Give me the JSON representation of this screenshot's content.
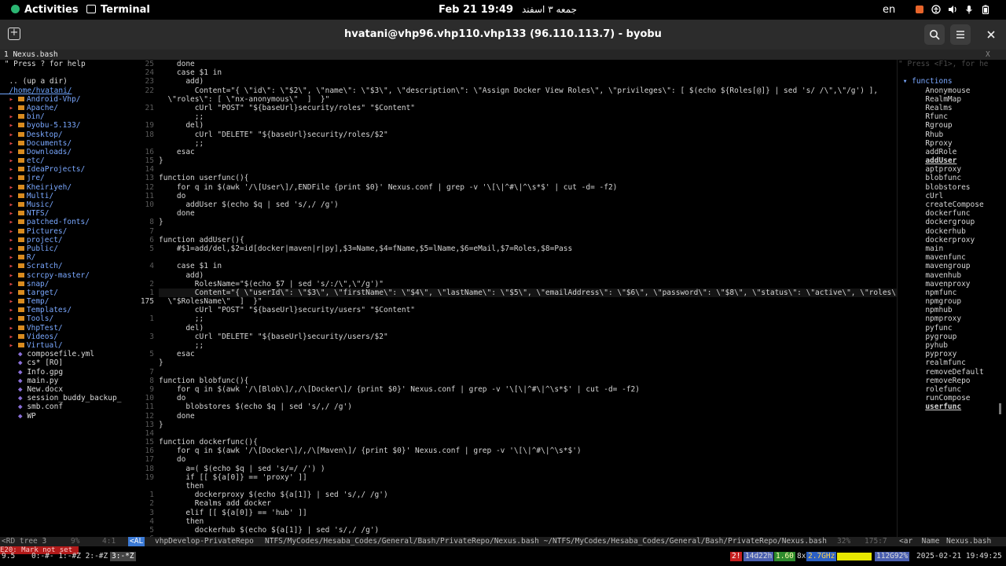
{
  "topbar": {
    "activities": "Activities",
    "app": "Terminal",
    "clock": "Feb 21  19:49",
    "persian_date": "جمعه ۳ اسفند",
    "lang": "en",
    "tray_icons": [
      "app-indicator-icon",
      "accessibility-icon",
      "volume-icon",
      "microphone-icon",
      "battery-icon"
    ]
  },
  "window": {
    "title": "hvatani@vhp96.vhp110.vhp133 (96.110.113.7) - byobu",
    "new_tab_icon": "new-tab-icon",
    "search_icon": "search-icon",
    "menu_icon": "hamburger-menu-icon",
    "close_icon": "close-icon"
  },
  "tabline": {
    "label": "1 Nexus.bash",
    "close": "X"
  },
  "tree": {
    "lines": [
      {
        "text": "\" Press ? for help",
        "kind": "help"
      },
      {
        "text": "",
        "kind": "help"
      },
      {
        "text": ".. (up a dir)",
        "kind": "file"
      },
      {
        "text": "/home/hvatani/",
        "kind": "root"
      },
      {
        "text": "Android-Vhp/",
        "kind": "dir"
      },
      {
        "text": "Apache/",
        "kind": "dir"
      },
      {
        "text": "bin/",
        "kind": "dir"
      },
      {
        "text": "byobu-5.133/",
        "kind": "dir"
      },
      {
        "text": "Desktop/",
        "kind": "dir"
      },
      {
        "text": "Documents/",
        "kind": "dir"
      },
      {
        "text": "Downloads/",
        "kind": "dir"
      },
      {
        "text": "etc/",
        "kind": "dir"
      },
      {
        "text": "IdeaProjects/",
        "kind": "dir"
      },
      {
        "text": "jre/",
        "kind": "dir"
      },
      {
        "text": "Kheiriyeh/",
        "kind": "dir"
      },
      {
        "text": "Multi/",
        "kind": "dir"
      },
      {
        "text": "Music/",
        "kind": "dir"
      },
      {
        "text": "NTFS/",
        "kind": "dir"
      },
      {
        "text": "patched-fonts/",
        "kind": "dir"
      },
      {
        "text": "Pictures/",
        "kind": "dir"
      },
      {
        "text": "project/",
        "kind": "dir"
      },
      {
        "text": "Public/",
        "kind": "dir"
      },
      {
        "text": "R/",
        "kind": "dir"
      },
      {
        "text": "Scratch/",
        "kind": "dir"
      },
      {
        "text": "scrcpy-master/",
        "kind": "dir"
      },
      {
        "text": "snap/",
        "kind": "dir"
      },
      {
        "text": "target/",
        "kind": "dir"
      },
      {
        "text": "Temp/",
        "kind": "dir"
      },
      {
        "text": "Templates/",
        "kind": "dir"
      },
      {
        "text": "Tools/",
        "kind": "dir"
      },
      {
        "text": "VhpTest/",
        "kind": "dir"
      },
      {
        "text": "Videos/",
        "kind": "dir"
      },
      {
        "text": "Virtual/",
        "kind": "dir"
      },
      {
        "text": "composefile.yml",
        "kind": "file"
      },
      {
        "text": "cs* [RO]",
        "kind": "file"
      },
      {
        "text": "Info.gpg",
        "kind": "file"
      },
      {
        "text": "main.py",
        "kind": "file"
      },
      {
        "text": "New.docx",
        "kind": "file"
      },
      {
        "text": "session_buddy_backup_",
        "kind": "file"
      },
      {
        "text": "smb.conf",
        "kind": "file"
      },
      {
        "text": "WP",
        "kind": "file"
      }
    ]
  },
  "gutter": [
    "25",
    "24",
    "23",
    "22",
    "",
    "21",
    "",
    "19",
    "18",
    "",
    "16",
    "15",
    "14",
    "13",
    "12",
    "11",
    "10",
    "",
    "8",
    "7",
    "6",
    "5",
    "",
    "4",
    "",
    "2",
    "1",
    "175",
    "",
    "1",
    "",
    "3",
    "",
    "5",
    "",
    "7",
    "8",
    "9",
    "10",
    "11",
    "12",
    "13",
    "14",
    "15",
    "16",
    "17",
    "18",
    "19",
    "",
    "1",
    "2",
    "3",
    "4",
    "5",
    "6",
    "7",
    ""
  ],
  "code": [
    {
      "text": "    done",
      "kw": true
    },
    {
      "text": "    case $1 in",
      "kw": true
    },
    {
      "text": "      add)"
    },
    {
      "text": "        Content=\"{ \\\"id\\\": \\\"$2\\\", \\\"name\\\": \\\"$3\\\", \\\"description\\\": \\\"Assign Docker View Roles\\\", \\\"privileges\\\": [ $(echo ${Roles[@]} | sed 's/ /\\\",\\\"/g') ],"
    },
    {
      "text": "  \\\"roles\\\": [ \\\"nx-anonymous\\\"  ]  }\""
    },
    {
      "text": "        cUrl \"POST\" \"${baseUrl}security/roles\" \"$Content\""
    },
    {
      "text": "        ;;",
      "cmt": true
    },
    {
      "text": "      del)"
    },
    {
      "text": "        cUrl \"DELETE\" \"${baseUrl}security/roles/$2\""
    },
    {
      "text": "        ;;",
      "cmt": true
    },
    {
      "text": "    esac",
      "kw": true
    },
    {
      "text": "}"
    },
    {
      "text": ""
    },
    {
      "text": "function userfunc(){"
    },
    {
      "text": "    for q in $(awk '/\\[User\\]/,ENDFile {print $0}' Nexus.conf | grep -v '\\[\\|^#\\|^\\s*$' | cut -d= -f2)"
    },
    {
      "text": "    do",
      "kw": true
    },
    {
      "text": "      addUser $(echo $q | sed 's/,/ /g')"
    },
    {
      "text": "    done",
      "kw": true
    },
    {
      "text": "}"
    },
    {
      "text": ""
    },
    {
      "text": "function addUser(){"
    },
    {
      "text": "    #$1=add/del,$2=id[docker|maven|r|py],$3=Name,$4=fName,$5=lName,$6=eMail,$7=Roles,$8=Pass",
      "cmt": true
    },
    {
      "text": ""
    },
    {
      "text": "    case $1 in",
      "kw": true
    },
    {
      "text": "      add)"
    },
    {
      "text": "        RolesName=\"$(echo $7 | sed 's/:/\\\",\\\"/g')\""
    },
    {
      "text": "        Content=\"{ \\\"userId\\\": \\\"$3\\\", \\\"firstName\\\": \\\"$4\\\", \\\"lastName\\\": \\\"$5\\\", \\\"emailAddress\\\": \\\"$6\\\", \\\"password\\\": \\\"$8\\\", \\\"status\\\": \\\"active\\\", \\\"roles\\\": [",
      "cur": true
    },
    {
      "text": "  \\\"$RolesName\\\"  ]  }\""
    },
    {
      "text": "        cUrl \"POST\" \"${baseUrl}security/users\" \"$Content\""
    },
    {
      "text": "        ;;",
      "cmt": true
    },
    {
      "text": "      del)"
    },
    {
      "text": "        cUrl \"DELETE\" \"${baseUrl}security/users/$2\""
    },
    {
      "text": "        ;;",
      "cmt": true
    },
    {
      "text": "    esac",
      "kw": true
    },
    {
      "text": "}"
    },
    {
      "text": ""
    },
    {
      "text": "function blobfunc(){"
    },
    {
      "text": "    for q in $(awk '/\\[Blob\\]/,/\\[Docker\\]/ {print $0}' Nexus.conf | grep -v '\\[\\|^#\\|^\\s*$' | cut -d= -f2)"
    },
    {
      "text": "    do",
      "kw": true
    },
    {
      "text": "      blobstores $(echo $q | sed 's/,/ /g')"
    },
    {
      "text": "    done",
      "kw": true
    },
    {
      "text": "}"
    },
    {
      "text": ""
    },
    {
      "text": "function dockerfunc(){"
    },
    {
      "text": "    for q in $(awk '/\\[Docker\\]/,/\\[Maven\\]/ {print $0}' Nexus.conf | grep -v '\\[\\|^#\\|^\\s*$')"
    },
    {
      "text": "    do",
      "kw": true
    },
    {
      "text": "      a=( $(echo $q | sed 's/=/ /') )"
    },
    {
      "text": "      if [[ ${a[0]} == 'proxy' ]]",
      "kw": true
    },
    {
      "text": "      then",
      "kw": true
    },
    {
      "text": "        dockerproxy $(echo ${a[1]} | sed 's/,/ /g')"
    },
    {
      "text": "        Realms add docker"
    },
    {
      "text": "      elif [[ ${a[0]} == 'hub' ]]",
      "kw": true
    },
    {
      "text": "      then",
      "kw": true
    },
    {
      "text": "        dockerhub $(echo ${a[1]} | sed 's/,/ /g')"
    }
  ],
  "tagbar": {
    "help": "\" Press <F1>, for he",
    "header": "functions",
    "items": [
      "Anonymouse",
      "RealmMap",
      "Realms",
      "Rfunc",
      "Rgroup",
      "Rhub",
      "Rproxy",
      "addRole",
      "addUser",
      "aptproxy",
      "blobfunc",
      "blobstores",
      "cUrl",
      "createCompose",
      "dockerfunc",
      "dockergroup",
      "dockerhub",
      "dockerproxy",
      "main",
      "mavenfunc",
      "mavengroup",
      "mavenhub",
      "mavenproxy",
      "npmfunc",
      "npmgroup",
      "npmhub",
      "npmproxy",
      "pyfunc",
      "pygroup",
      "pyhub",
      "pyproxy",
      "realmfunc",
      "removeDefault",
      "removeRepo",
      "rolefunc",
      "runCompose",
      "userfunc"
    ],
    "selected": [
      "addUser",
      "userfunc"
    ]
  },
  "statusline": {
    "left": "<RD tree 3",
    "left_pct": "9%",
    "left_pos": "4:1",
    "mode": "<AL",
    "branch": "vhpDevelop-PrivateRepo",
    "path": "NTFS/MyCodes/Hesaba_Codes/General/Bash/PrivateRepo/Nexus.bash ~/NTFS/MyCodes/Hesaba_Codes/General/Bash/PrivateRepo/Nexus.bash",
    "pct": "32%",
    "pos": "175:7",
    "tag": "<ar  Name",
    "file": "Nexus.bash"
  },
  "message": "E20: Mark not set",
  "byobu": {
    "version": "9.5",
    "windows": "0:-#- 1:-#Z 2:-#Z",
    "active_window": "3:-*Z",
    "updates": "2!",
    "uptime": "14d22h",
    "load": "1.60",
    "cpu": "8x",
    "ghz": "2.7GHz",
    "mem": "112G92%",
    "datetime": "2025-02-21 19:49:25"
  }
}
